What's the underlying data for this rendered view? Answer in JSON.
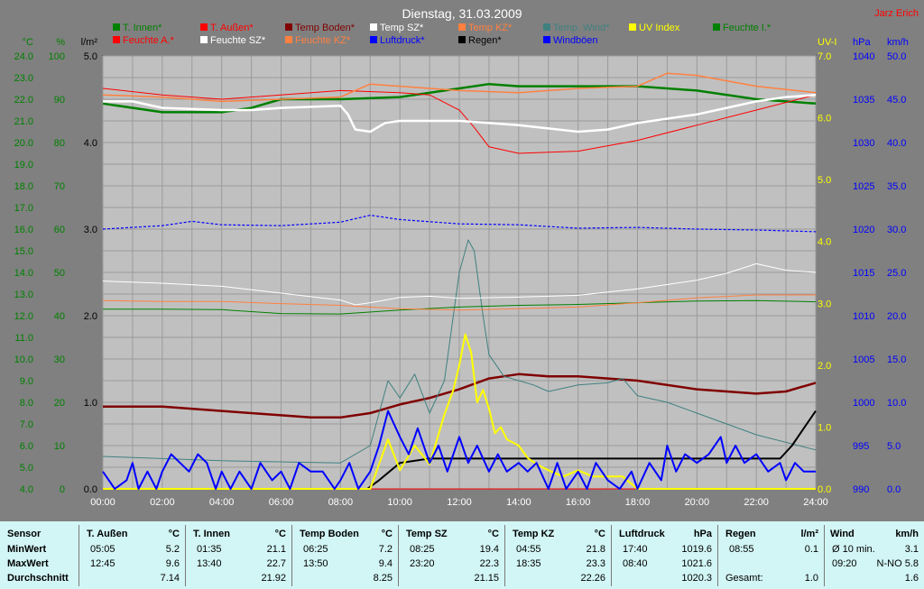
{
  "chart_data": {
    "type": "line",
    "title": "Dienstag, 31.03.2009",
    "author": "Jarz Erich",
    "x_ticks": [
      "00:00",
      "02:00",
      "04:00",
      "06:00",
      "08:00",
      "10:00",
      "12:00",
      "14:00",
      "16:00",
      "18:00",
      "20:00",
      "22:00",
      "24:00"
    ],
    "axes": [
      {
        "unit": "°C",
        "color": "#008000",
        "min": 4.0,
        "max": 24.0,
        "step": 1.0,
        "decimals": 1
      },
      {
        "unit": "%",
        "color": "#008000",
        "min": 0,
        "max": 100,
        "step": 10,
        "decimals": 0
      },
      {
        "unit": "l/m²",
        "color": "#000000",
        "min": 0.0,
        "max": 5.0,
        "step": 1.0,
        "decimals": 1
      },
      {
        "unit": "UV-I",
        "color": "#ffff00",
        "min": 0.0,
        "max": 7.0,
        "step": 1.0,
        "decimals": 1
      },
      {
        "unit": "hPa",
        "color": "#0000ff",
        "min": 990,
        "max": 1040,
        "step": 5,
        "decimals": 0
      },
      {
        "unit": "km/h",
        "color": "#0000ff",
        "min": 0.0,
        "max": 50.0,
        "step": 5.0,
        "decimals": 1
      }
    ],
    "legend": [
      {
        "label": "T. Innen*",
        "color": "#008000"
      },
      {
        "label": "T. Außen*",
        "color": "#ff0000"
      },
      {
        "label": "Temp Boden*",
        "color": "#800000"
      },
      {
        "label": "Temp SZ*",
        "color": "#ffffff"
      },
      {
        "label": "Temp KZ*",
        "color": "#ff8040"
      },
      {
        "label": "Temp. Wind*",
        "color": "#408080"
      },
      {
        "label": "UV Index",
        "color": "#ffff00"
      },
      {
        "label": "Feuchte I.*",
        "color": "#008000"
      },
      {
        "label": "Feuchte A.*",
        "color": "#ff0000"
      },
      {
        "label": "Feuchte SZ*",
        "color": "#ffffff"
      },
      {
        "label": "Feuchte KZ*",
        "color": "#ff8040"
      },
      {
        "label": "Luftdruck*",
        "color": "#0000ff"
      },
      {
        "label": "Regen*",
        "color": "#000000"
      },
      {
        "label": "Windböen",
        "color": "#0000ff"
      }
    ],
    "series": [
      {
        "name": "T. Innen*",
        "axis": 0,
        "color": "#008000",
        "width": 2.5,
        "x": [
          0,
          2,
          4,
          5,
          6,
          8,
          10,
          12,
          13,
          14,
          16,
          18,
          20,
          22,
          24
        ],
        "y": [
          21.8,
          21.4,
          21.4,
          21.6,
          22.0,
          22.0,
          22.1,
          22.5,
          22.7,
          22.6,
          22.6,
          22.6,
          22.4,
          22.0,
          21.8
        ]
      },
      {
        "name": "T. Außen*",
        "axis": 0,
        "color": "#ff0000",
        "width": 1,
        "x": [
          0,
          2,
          4,
          6,
          8,
          10,
          11,
          12,
          12.5,
          13,
          14,
          16,
          18,
          20,
          22,
          24
        ],
        "y": [
          22.5,
          22.2,
          22.0,
          22.2,
          22.4,
          22.3,
          22.2,
          21.5,
          20.7,
          19.8,
          19.5,
          19.6,
          20.1,
          20.8,
          21.5,
          22.2
        ]
      },
      {
        "name": "Temp Boden*",
        "axis": 0,
        "color": "#800000",
        "width": 2.5,
        "x": [
          0,
          2,
          4,
          6,
          7,
          8,
          9,
          10,
          11,
          12,
          13,
          14,
          15,
          16,
          18,
          20,
          22,
          23,
          24
        ],
        "y": [
          7.8,
          7.8,
          7.6,
          7.4,
          7.3,
          7.3,
          7.5,
          7.9,
          8.2,
          8.6,
          9.1,
          9.3,
          9.2,
          9.2,
          9.0,
          8.6,
          8.4,
          8.5,
          8.9
        ]
      },
      {
        "name": "Temp SZ*",
        "axis": 0,
        "color": "#ffffff",
        "width": 2.5,
        "x": [
          0,
          1,
          2,
          4,
          5,
          6,
          8,
          8.25,
          8.5,
          9,
          9.5,
          10,
          12,
          14,
          16,
          17,
          18,
          20,
          21,
          22,
          23,
          24
        ],
        "y": [
          21.9,
          21.9,
          21.6,
          21.5,
          21.5,
          21.6,
          21.7,
          21.3,
          20.6,
          20.5,
          20.9,
          21.0,
          21.0,
          20.8,
          20.5,
          20.6,
          20.9,
          21.3,
          21.6,
          21.9,
          22.1,
          22.2
        ]
      },
      {
        "name": "Temp KZ*",
        "axis": 0,
        "color": "#ff8040",
        "width": 1.5,
        "x": [
          0,
          2,
          4,
          6,
          8,
          9,
          10,
          12,
          14,
          16,
          18,
          19,
          20,
          22,
          24
        ],
        "y": [
          22.2,
          22.1,
          21.9,
          22.0,
          22.1,
          22.7,
          22.6,
          22.4,
          22.3,
          22.5,
          22.6,
          23.2,
          23.1,
          22.6,
          22.3
        ]
      },
      {
        "name": "Temp. Wind*",
        "axis": 0,
        "color": "#408080",
        "width": 1,
        "x": [
          0,
          4,
          8,
          9,
          9.6,
          10,
          10.5,
          11,
          11.5,
          12,
          12.3,
          12.5,
          12.8,
          13,
          13.5,
          14,
          14.5,
          15,
          16,
          17,
          17.5,
          18,
          19,
          20,
          22,
          24
        ],
        "y": [
          5.5,
          5.3,
          5.2,
          6.0,
          9.0,
          8.2,
          9.3,
          7.5,
          9.0,
          14.0,
          15.5,
          15.0,
          12.0,
          10.2,
          9.2,
          9.0,
          8.8,
          8.5,
          8.8,
          8.9,
          9.1,
          8.3,
          8.0,
          7.5,
          6.5,
          5.8
        ]
      },
      {
        "name": "Feuchte I.*",
        "axis": 1,
        "color": "#008000",
        "width": 1,
        "x": [
          0,
          2,
          4,
          6,
          8,
          10,
          12,
          14,
          16,
          18,
          20,
          22,
          24
        ],
        "y": [
          41.5,
          41.5,
          41.4,
          40.5,
          40.4,
          41.3,
          42.0,
          42.4,
          42.6,
          43.0,
          43.4,
          43.5,
          43.2
        ]
      },
      {
        "name": "Feuchte A.*",
        "axis": 1,
        "color": "#ff0000",
        "width": 1,
        "x": [
          0,
          24
        ],
        "y": [
          0,
          0
        ]
      },
      {
        "name": "Feuchte SZ*",
        "axis": 1,
        "color": "#ffffff",
        "width": 1,
        "x": [
          0,
          2,
          4,
          6,
          8,
          8.5,
          9,
          10,
          11,
          12,
          14,
          16,
          18,
          20,
          21,
          22,
          23,
          24
        ],
        "y": [
          48.0,
          47.5,
          46.8,
          45.2,
          43.6,
          42.5,
          43.0,
          44.2,
          44.5,
          44.0,
          44.3,
          44.7,
          46.2,
          48.2,
          49.8,
          52.0,
          50.5,
          50.0
        ]
      },
      {
        "name": "Feuchte KZ*",
        "axis": 1,
        "color": "#ff8040",
        "width": 1,
        "x": [
          0,
          2,
          4,
          6,
          8,
          10,
          12,
          14,
          16,
          18,
          20,
          22,
          24
        ],
        "y": [
          43.5,
          43.3,
          43.3,
          42.8,
          42.4,
          41.6,
          41.3,
          41.6,
          42.0,
          43.0,
          44.1,
          44.8,
          44.8
        ]
      },
      {
        "name": "Luftdruck*",
        "axis": 4,
        "color": "#0000ff",
        "width": 1.2,
        "dash": "3,2",
        "x": [
          0,
          2,
          3,
          4,
          6,
          8,
          9,
          10,
          12,
          14,
          16,
          18,
          20,
          22,
          24
        ],
        "y": [
          1020.0,
          1020.4,
          1020.9,
          1020.5,
          1020.4,
          1020.8,
          1021.6,
          1021.1,
          1020.6,
          1020.5,
          1020.1,
          1020.2,
          1020.0,
          1019.9,
          1019.7
        ]
      },
      {
        "name": "Regen*",
        "axis": 2,
        "color": "#000000",
        "width": 2,
        "x": [
          0,
          8.9,
          9.3,
          10,
          11,
          11.5,
          12,
          22.8,
          23.2,
          23.6,
          24
        ],
        "y": [
          0,
          0,
          0.1,
          0.3,
          0.35,
          0.35,
          0.35,
          0.35,
          0.5,
          0.7,
          0.9
        ]
      },
      {
        "name": "UV Index",
        "axis": 3,
        "color": "#ffff00",
        "width": 2,
        "x": [
          0,
          8.8,
          9,
          9.3,
          9.6,
          10,
          10.5,
          11,
          11.5,
          11.8,
          12,
          12.2,
          12.4,
          12.6,
          12.8,
          13,
          13.2,
          13.4,
          13.6,
          14,
          14.3,
          14.6,
          15,
          15.5,
          16,
          16.5,
          17,
          17.5,
          18,
          24
        ],
        "y": [
          0,
          0,
          0,
          0.4,
          0.8,
          0.3,
          0.7,
          0.4,
          1.2,
          1.6,
          2.0,
          2.5,
          2.2,
          1.4,
          1.6,
          1.3,
          0.9,
          1.0,
          0.8,
          0.7,
          0.5,
          0.4,
          0.3,
          0.2,
          0.3,
          0.2,
          0.2,
          0.2,
          0,
          0
        ]
      },
      {
        "name": "Windböen",
        "axis": 5,
        "color": "#0000ff",
        "width": 2,
        "x": [
          0,
          0.4,
          0.8,
          1,
          1.2,
          1.5,
          1.8,
          2,
          2.3,
          2.6,
          2.9,
          3.2,
          3.5,
          3.8,
          4,
          4.3,
          4.6,
          5,
          5.3,
          5.7,
          6,
          6.3,
          6.6,
          7,
          7.4,
          7.8,
          8,
          8.3,
          8.6,
          9,
          9.3,
          9.6,
          10,
          10.3,
          10.6,
          11,
          11.3,
          11.6,
          12,
          12.3,
          12.6,
          13,
          13.3,
          13.6,
          14,
          14.3,
          14.6,
          15,
          15.3,
          15.6,
          16,
          16.3,
          16.6,
          17,
          17.4,
          17.8,
          18,
          18.4,
          18.8,
          19,
          19.3,
          19.6,
          20,
          20.4,
          20.8,
          21,
          21.3,
          21.6,
          22,
          22.4,
          22.8,
          23,
          23.3,
          23.6,
          24
        ],
        "y": [
          2,
          0,
          1,
          3,
          0,
          2,
          0,
          2,
          4,
          3,
          2,
          4,
          3,
          0,
          2,
          0,
          2,
          0,
          3,
          1,
          2,
          0,
          3,
          2,
          2,
          0,
          1,
          3,
          0,
          2,
          5,
          9,
          6,
          4,
          7,
          3,
          5,
          2,
          6,
          3,
          5,
          2,
          4,
          2,
          3,
          2,
          3,
          0,
          3,
          0,
          2,
          0,
          3,
          1,
          0,
          2,
          0,
          3,
          1,
          5,
          2,
          4,
          3,
          4,
          6,
          3,
          5,
          3,
          4,
          2,
          3,
          1,
          3,
          2,
          2
        ]
      },
      {
        "name": "Boeen-2",
        "axis": 5,
        "color": "#0000ff",
        "width": 2,
        "x": [
          24
        ],
        "y": [
          0
        ]
      }
    ]
  },
  "stats": {
    "row_labels": {
      "header": "Sensor",
      "min": "MinWert",
      "max": "MaxWert",
      "avg": "Durchschnitt"
    },
    "columns": [
      {
        "title": "T. Außen",
        "unit": "°C",
        "min_time": "05:05",
        "min_val": "5.2",
        "max_time": "12:45",
        "max_val": "9.6",
        "avg": "7.14"
      },
      {
        "title": "T. Innen",
        "unit": "°C",
        "min_time": "01:35",
        "min_val": "21.1",
        "max_time": "13:40",
        "max_val": "22.7",
        "avg": "21.92"
      },
      {
        "title": "Temp Boden",
        "unit": "°C",
        "min_time": "06:25",
        "min_val": "7.2",
        "max_time": "13:50",
        "max_val": "9.4",
        "avg": "8.25"
      },
      {
        "title": "Temp SZ",
        "unit": "°C",
        "min_time": "08:25",
        "min_val": "19.4",
        "max_time": "23:20",
        "max_val": "22.3",
        "avg": "21.15"
      },
      {
        "title": "Temp KZ",
        "unit": "°C",
        "min_time": "04:55",
        "min_val": "21.8",
        "max_time": "18:35",
        "max_val": "23.3",
        "avg": "22.26"
      },
      {
        "title": "Luftdruck",
        "unit": "hPa",
        "min_time": "17:40",
        "min_val": "1019.6",
        "max_time": "08:40",
        "max_val": "1021.6",
        "avg": "1020.3"
      },
      {
        "title": "Regen",
        "unit": "l/m²",
        "min_time": "08:55",
        "min_val": "0.1",
        "max_time": "Gesamt:",
        "max_val": "1.0",
        "avg": ""
      },
      {
        "title": "Wind",
        "unit": "km/h",
        "min_time": "Ø 10 min.",
        "min_val": "3.1",
        "max_time": "09:20",
        "max_val": "N-NO 5.8",
        "avg": "1.6"
      }
    ]
  }
}
